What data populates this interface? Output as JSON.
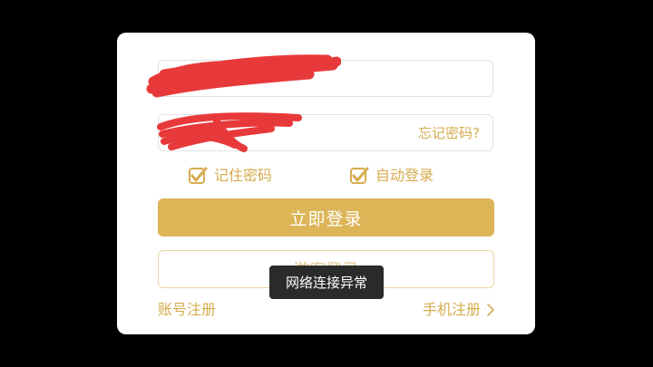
{
  "dialog": {
    "password_hint": "忘记密码?",
    "remember_label": "记住密码",
    "autologin_label": "自动登录",
    "remember_checked": true,
    "autologin_checked": true,
    "login_button": "立即登录",
    "guest_button": "游客登录",
    "register_link": "账号注册",
    "phone_register_link": "手机注册"
  },
  "toast": {
    "message": "网络连接异常"
  },
  "colors": {
    "accent": "#dcb557",
    "accent_text": "#d6ac4f",
    "redaction": "#e8393a",
    "toast_bg": "#2b2b2b",
    "backdrop": "#000000"
  },
  "icons": [
    "checkbox-checked-icon",
    "chevron-right-icon"
  ]
}
